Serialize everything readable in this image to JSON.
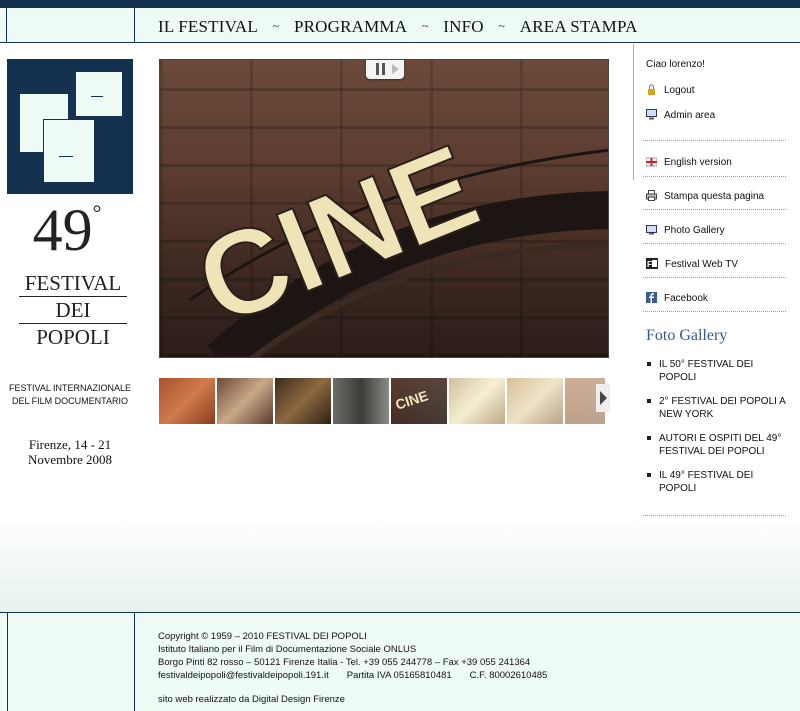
{
  "nav": {
    "items": [
      "IL FESTIVAL",
      "PROGRAMMA",
      "INFO",
      "AREA STAMPA"
    ],
    "separator": "~"
  },
  "festival": {
    "number": "49",
    "degree": "°",
    "name_lines": [
      "FESTIVAL",
      "DEI",
      "POPOLI"
    ],
    "subtitle_lines": [
      "FESTIVAL INTERNAZIONALE",
      "DEL FILM DOCUMENTARIO"
    ],
    "date_lines": [
      "Firenze, 14 - 21",
      "Novembre 2008"
    ]
  },
  "slideshow": {
    "sign_text": "CINE"
  },
  "sidebar": {
    "greeting": "Ciao lorenzo!",
    "user_links": [
      {
        "label": "Logout",
        "icon": "lock-icon"
      },
      {
        "label": "Admin area",
        "icon": "monitor-icon"
      }
    ],
    "links": [
      {
        "label": "English version",
        "icon": "uk-flag-icon"
      },
      {
        "label": "Stampa questa pagina",
        "icon": "printer-icon"
      },
      {
        "label": "Photo Gallery",
        "icon": "gallery-icon"
      },
      {
        "label": "Festival Web TV",
        "icon": "webtv-icon"
      },
      {
        "label": "Facebook",
        "icon": "facebook-icon"
      }
    ],
    "gallery_title": "Foto Gallery",
    "gallery_items": [
      "IL 50° FESTIVAL DEI POPOLI",
      "2° FESTIVAL DEI POPOLI A NEW YORK",
      "AUTORI E OSPITI DEL 49° FESTIVAL DEI POPOLI",
      "IL 49° FESTIVAL DEI POPOLI"
    ]
  },
  "footer": {
    "copyright": "Copyright © 1959 – 2010 FESTIVAL DEI POPOLI",
    "institute": "Istituto Italiano per il Film di Documentazione Sociale ONLUS",
    "address": "Borgo Pinti 82 rosso – 50121 Firenze Italia - Tel. +39 055 244778 – Fax +39 055 241364",
    "email": "festivaldeipopoli@festivaldeipopoli.191.it",
    "piva": "Partita IVA 05165810481",
    "cf": "C.F. 80002610485",
    "credit": "sito web realizzato da Digital Design Firenze"
  },
  "colors": {
    "navy": "#14314f",
    "mint": "#eefbf5",
    "gallery_title": "#34598a"
  }
}
